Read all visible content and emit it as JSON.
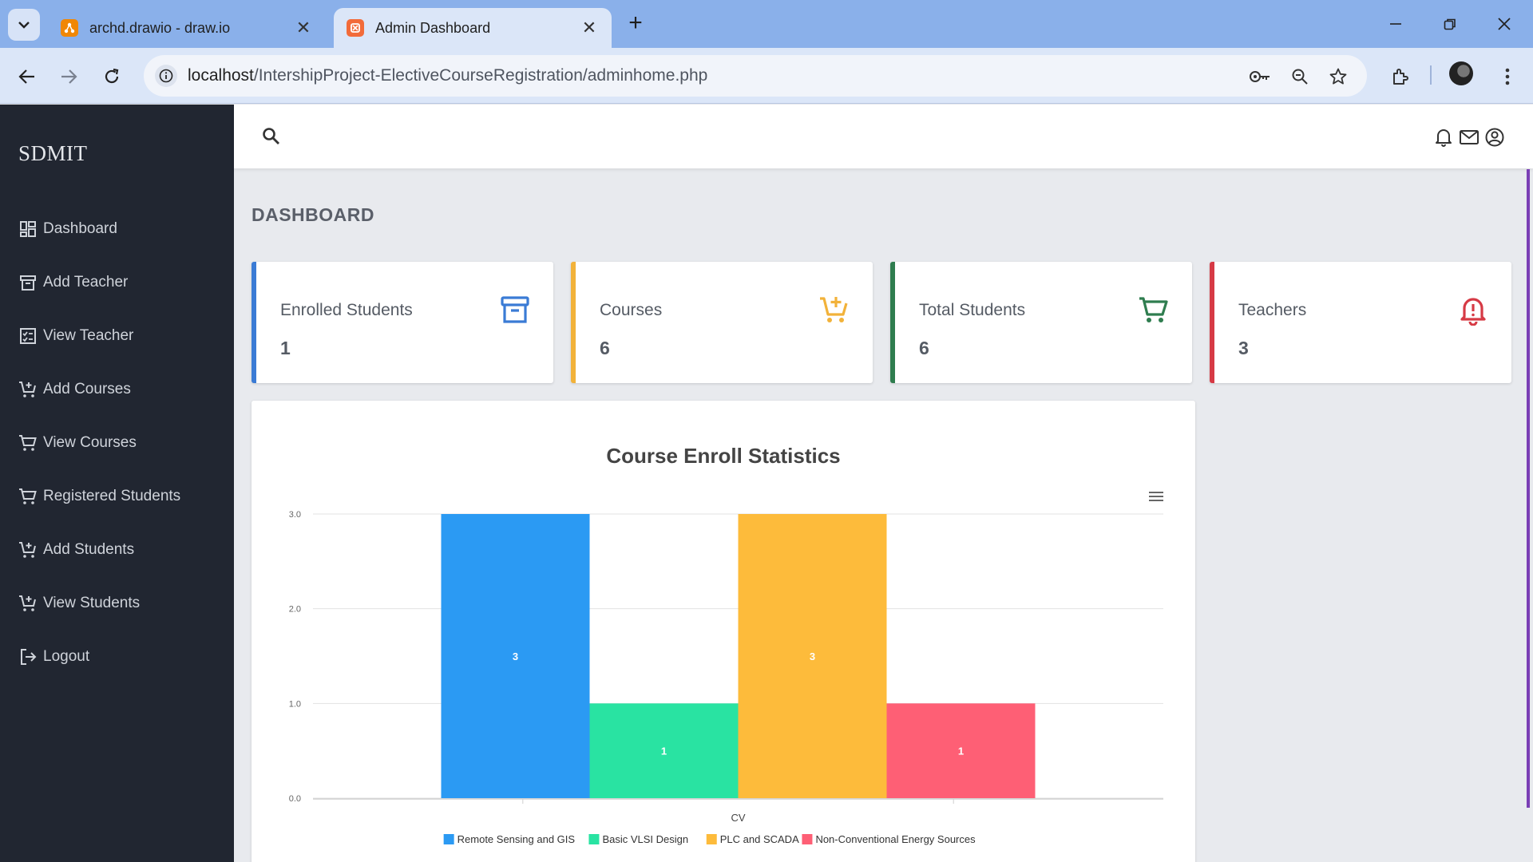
{
  "browser": {
    "tabs": [
      {
        "title": "archd.drawio - draw.io",
        "favicon": "drawio-icon",
        "active": false
      },
      {
        "title": "Admin Dashboard",
        "favicon": "xampp-icon",
        "active": true
      }
    ],
    "url_host": "localhost",
    "url_path": "/IntershipProject-ElectiveCourseRegistration/adminhome.php"
  },
  "sidebar": {
    "brand": "SDMIT",
    "items": [
      {
        "label": "Dashboard",
        "icon": "dashboard-icon"
      },
      {
        "label": "Add Teacher",
        "icon": "archive-icon"
      },
      {
        "label": "View Teacher",
        "icon": "checklist-icon"
      },
      {
        "label": "Add Courses",
        "icon": "cart-plus-icon"
      },
      {
        "label": "View Courses",
        "icon": "cart-icon"
      },
      {
        "label": "Registered Students",
        "icon": "cart-icon"
      },
      {
        "label": "Add Students",
        "icon": "cart-plus-icon"
      },
      {
        "label": "View Students",
        "icon": "cart-plus-icon"
      },
      {
        "label": "Logout",
        "icon": "logout-icon"
      }
    ]
  },
  "main": {
    "title": "DASHBOARD",
    "cards": [
      {
        "label": "Enrolled Students",
        "value": "1",
        "color": "#3a7bd5",
        "icon": "archive-icon"
      },
      {
        "label": "Courses",
        "value": "6",
        "color": "#f2b23a",
        "icon": "cart-plus-icon"
      },
      {
        "label": "Total Students",
        "value": "6",
        "color": "#2f7d4f",
        "icon": "cart-icon"
      },
      {
        "label": "Teachers",
        "value": "3",
        "color": "#d63a45",
        "icon": "bell-alert-icon"
      }
    ]
  },
  "chart_data": {
    "type": "bar",
    "title": "Course Enroll Statistics",
    "categories": [
      "CV"
    ],
    "series": [
      {
        "name": "Remote Sensing and GIS",
        "values": [
          3
        ],
        "color": "#2b9af3"
      },
      {
        "name": "Basic VLSI Design",
        "values": [
          1
        ],
        "color": "#29e3a2"
      },
      {
        "name": "PLC and SCADA",
        "values": [
          3
        ],
        "color": "#fdbb3b"
      },
      {
        "name": "Non-Conventional Energy Sources",
        "values": [
          1
        ],
        "color": "#fe5f75"
      }
    ],
    "ylim": [
      0,
      3
    ],
    "yticks": [
      "0.0",
      "1.0",
      "2.0",
      "3.0"
    ],
    "data_labels": true,
    "grid": true,
    "legend": "bottom-center"
  }
}
